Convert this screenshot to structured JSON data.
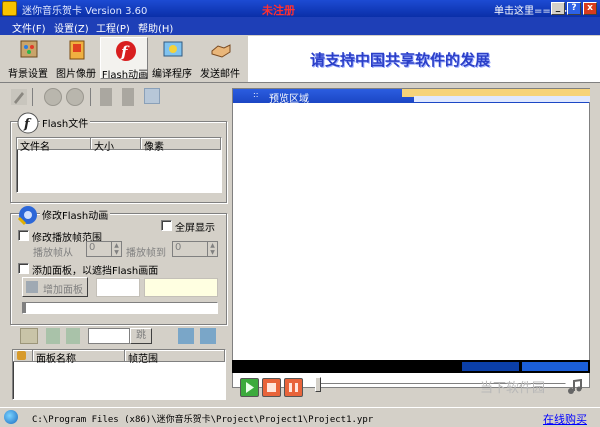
{
  "window": {
    "title": "迷你音乐贺卡 Version 3.60",
    "unregistered": "未注册",
    "click_here": "单击这里==>>",
    "help_btn": "?",
    "close_btn": "x",
    "min_btn": "_"
  },
  "menu": [
    "文件(F)",
    "设置(Z)",
    "工程(P)",
    "帮助(H)"
  ],
  "toolbar": {
    "items": [
      {
        "label": "背景设置",
        "icon": "palette-icon",
        "active": false
      },
      {
        "label": "图片像册",
        "icon": "photo-album-icon",
        "active": false
      },
      {
        "label": "Flash动画",
        "icon": "flash-icon",
        "active": true
      },
      {
        "label": "编译程序",
        "icon": "compile-icon",
        "active": false
      },
      {
        "label": "发送邮件",
        "icon": "handshake-mail-icon",
        "active": false
      }
    ]
  },
  "banner": {
    "text": "请支持中国共享软件的发展"
  },
  "flash_files": {
    "group_title": "Flash文件",
    "columns": [
      "文件名",
      "大小",
      "像素"
    ],
    "rows": []
  },
  "modify_flash": {
    "group_title": "修改Flash动画",
    "fullscreen_label": "全屏显示",
    "fullscreen_checked": false,
    "modify_range_label": "修改播放帧范围",
    "modify_range_checked": false,
    "from_label": "播放帧从",
    "from_value": "0",
    "to_label": "播放帧到",
    "to_value": "0",
    "add_panel_label": "添加面板，以遮挡Flash画面",
    "add_panel_checked": false,
    "add_panel_button": "增加面板"
  },
  "panel_list": {
    "jump_label": "跳",
    "columns": [
      "面板名称",
      "帧范围"
    ],
    "rows": []
  },
  "preview": {
    "title": "预览区域",
    "dots": "::"
  },
  "playback": {
    "play": "play-icon",
    "stop": "stop-icon",
    "pause": "pause-icon"
  },
  "status": {
    "path": "C:\\Program Files (x86)\\迷你音乐贺卡\\Project\\Project1\\Project1.ypr",
    "buy_link": "在线购买"
  },
  "watermark": "当下软件园",
  "colors": {
    "titlebar": "#1d4bd3",
    "menubar": "#1e3fb7",
    "banner_text": "#2b3fc8",
    "unregistered": "#ff3030",
    "link": "#0000ff"
  }
}
